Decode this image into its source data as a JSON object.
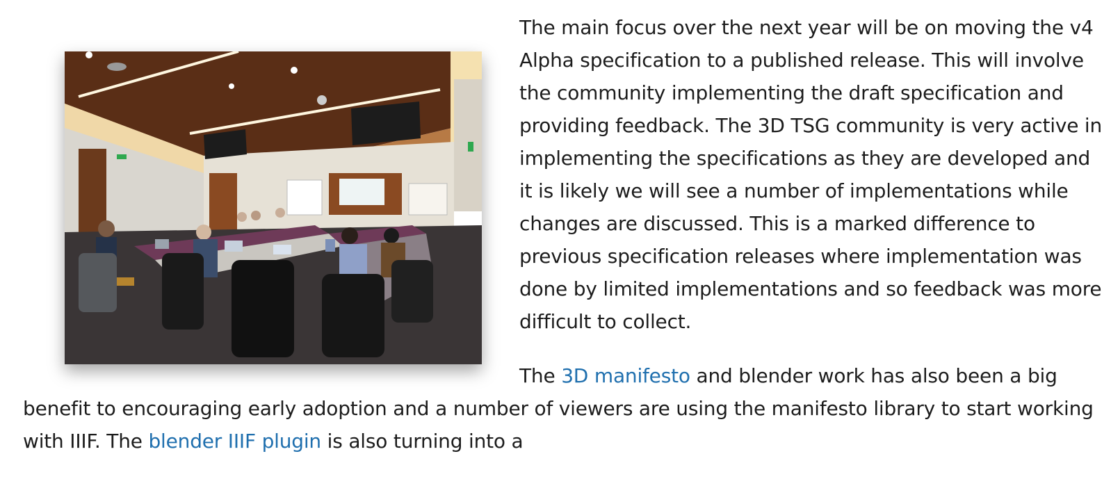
{
  "article": {
    "photo_icon": "meeting-room-photo",
    "paragraph1": "The main focus over the next year will be on moving the v4 Alpha specification to a published release. This will involve the community implementing the draft specification and providing feedback. The 3D TSG community is very active in implementing the specifications as they are developed and it is likely we will see a number of implementations while changes are discussed. This is a marked difference to previous specification releases where implementation was done by limited implementations and so feedback was more difficult to collect.",
    "p2_part1": "The ",
    "link_3d_manifesto": "3D manifesto",
    "p2_part2": " and blender work has also been a big benefit to encouraging early adoption and a number of viewers are using the manifesto library to start working with IIIF. The ",
    "link_blender_plugin": "blender IIIF plugin",
    "p2_part3": " is also turning into a",
    "link_color": "#1f6fae"
  }
}
